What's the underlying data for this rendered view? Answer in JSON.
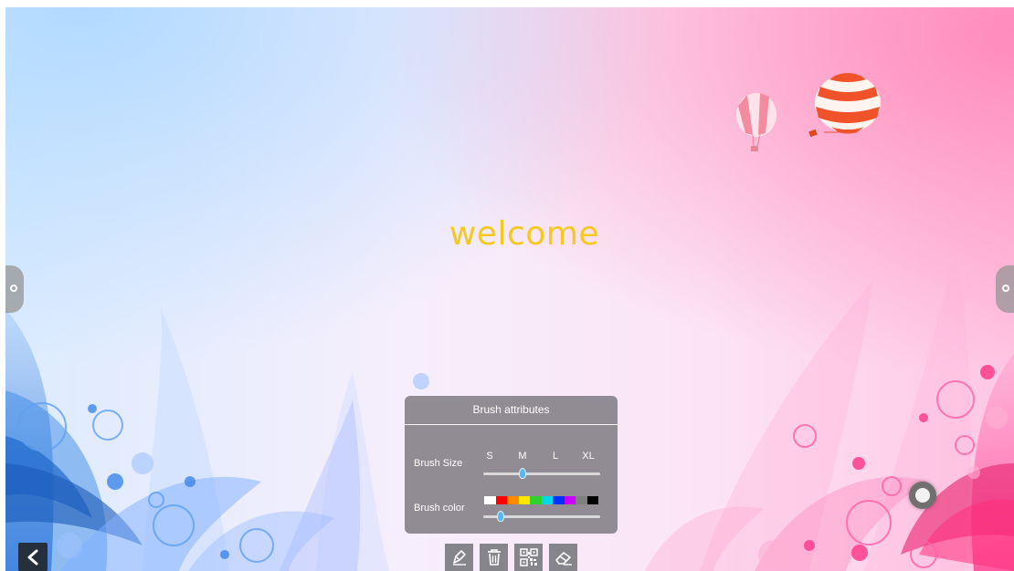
{
  "canvas": {
    "welcome_text": "welcome"
  },
  "brush_panel": {
    "title": "Brush attributes",
    "size_label": "Brush Size",
    "size_options": [
      "S",
      "M",
      "L",
      "XL"
    ],
    "selected_size": "M",
    "color_label": "Brush color",
    "colors": [
      "#ffffff",
      "#ff0000",
      "#ff8a00",
      "#ffe600",
      "#2fd12f",
      "#00d8e8",
      "#0033ff",
      "#c800ff",
      "#808080",
      "#000000"
    ],
    "selected_color_index": 0
  },
  "toolbar": {
    "tools": [
      {
        "name": "pen-tool",
        "icon": "pen-icon"
      },
      {
        "name": "delete-tool",
        "icon": "trash-icon"
      },
      {
        "name": "qr-tool",
        "icon": "qr-code-icon"
      },
      {
        "name": "eraser-tool",
        "icon": "eraser-icon"
      }
    ]
  },
  "navigation": {
    "back_icon": "chevron-left-icon"
  }
}
